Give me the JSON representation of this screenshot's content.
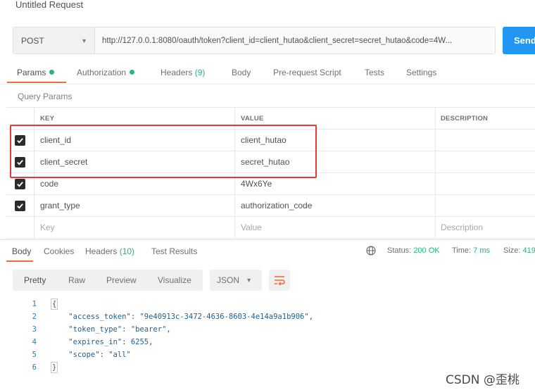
{
  "request": {
    "title": "Untitled Request",
    "method": "POST",
    "url": "http://127.0.0.1:8080/oauth/token?client_id=client_hutao&client_secret=secret_hutao&code=4W...",
    "send_label": "Send"
  },
  "request_tabs": [
    {
      "label": "Params",
      "dot": true
    },
    {
      "label": "Authorization",
      "dot": true
    },
    {
      "label": "Headers",
      "count": "(9)"
    },
    {
      "label": "Body"
    },
    {
      "label": "Pre-request Script"
    },
    {
      "label": "Tests"
    },
    {
      "label": "Settings"
    }
  ],
  "query_params": {
    "section_label": "Query Params",
    "headers": {
      "key": "KEY",
      "value": "VALUE",
      "description": "DESCRIPTION"
    },
    "rows": [
      {
        "checked": true,
        "key": "client_id",
        "value": "client_hutao",
        "description": ""
      },
      {
        "checked": true,
        "key": "client_secret",
        "value": "secret_hutao",
        "description": ""
      },
      {
        "checked": true,
        "key": "code",
        "value": "4Wx6Ye",
        "description": ""
      },
      {
        "checked": true,
        "key": "grant_type",
        "value": "authorization_code",
        "description": ""
      }
    ],
    "placeholders": {
      "key": "Key",
      "value": "Value",
      "description": "Description"
    }
  },
  "response_tabs": [
    {
      "label": "Body"
    },
    {
      "label": "Cookies"
    },
    {
      "label": "Headers",
      "count": "(10)"
    },
    {
      "label": "Test Results"
    }
  ],
  "response_status": {
    "status_label": "Status:",
    "status_value": "200 OK",
    "time_label": "Time:",
    "time_value": "7 ms",
    "size_label": "Size:",
    "size_value": "419"
  },
  "format_options": [
    "Pretty",
    "Raw",
    "Preview",
    "Visualize"
  ],
  "format_selected": "Pretty",
  "language_select": "JSON",
  "response_body_lines": [
    {
      "num": "1",
      "text": "{"
    },
    {
      "num": "2",
      "key": "\"access_token\"",
      "value": "\"9e40913c-3472-4636-8603-4e14a9a1b906\"",
      "trail": ","
    },
    {
      "num": "3",
      "key": "\"token_type\"",
      "value": "\"bearer\"",
      "trail": ","
    },
    {
      "num": "4",
      "key": "\"expires_in\"",
      "value": "6255",
      "trail": ","
    },
    {
      "num": "5",
      "key": "\"scope\"",
      "value": "\"all\"",
      "trail": ""
    },
    {
      "num": "6",
      "text": "}"
    }
  ],
  "watermark": "CSDN @歪桃",
  "colors": {
    "accent_orange": "#f26b3a",
    "status_green": "#26b47f",
    "send_blue": "#2196f3",
    "highlight_red": "#e53935"
  }
}
